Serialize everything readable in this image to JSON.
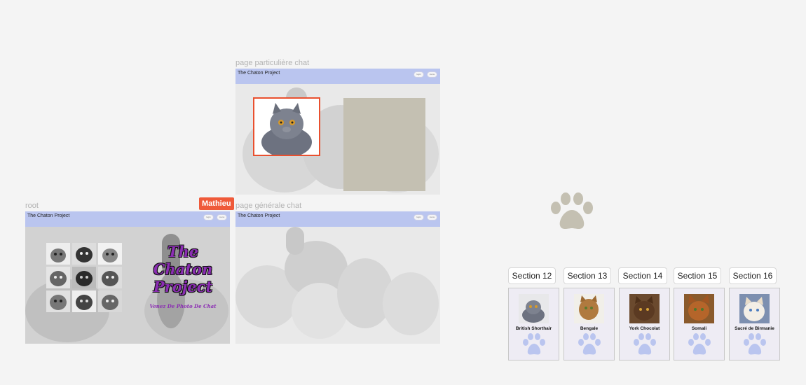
{
  "frames": {
    "particuliere": {
      "label": "page particulière chat",
      "title": "The Chaton Project"
    },
    "root": {
      "label": "root",
      "title": "The Chaton Project",
      "logo": [
        "The",
        "Chaton",
        "Project"
      ],
      "tagline": "Venez De Photo De Chat"
    },
    "generale": {
      "label": "page générale chat",
      "title": "The Chaton Project"
    }
  },
  "collaborator": {
    "name": "Mathieu",
    "color": "#ef5a3a"
  },
  "sections": [
    {
      "label": "Section 12",
      "breed": "British Shorthair"
    },
    {
      "label": "Section 13",
      "breed": "Bengale"
    },
    {
      "label": "Section 14",
      "breed": "York Chocolat"
    },
    {
      "label": "Section 15",
      "breed": "Somali"
    },
    {
      "label": "Section 16",
      "breed": "Sacré de Birmanie"
    }
  ],
  "colors": {
    "header": "#bac5ef",
    "accent": "#ef5a3a",
    "paw": "#c4c0b2",
    "placeholder": "#c4c0b2",
    "logo": "#8b2db3"
  }
}
